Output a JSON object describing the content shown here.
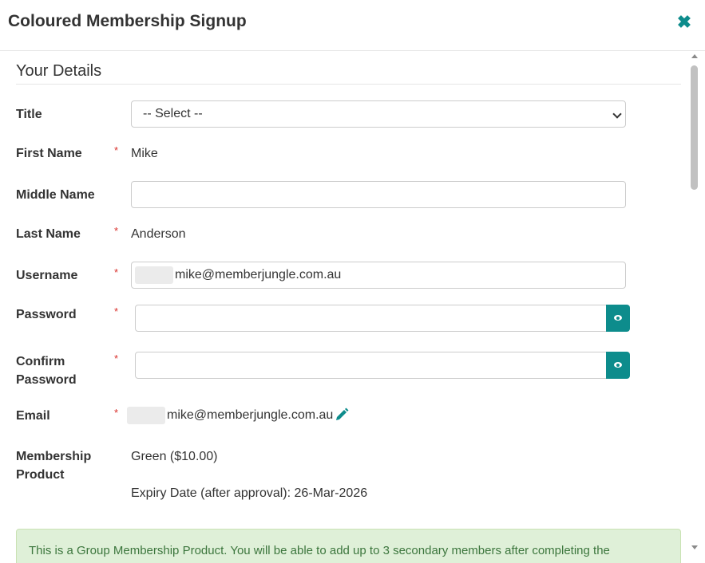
{
  "modal": {
    "title": "Coloured Membership Signup",
    "close_icon": "close-icon"
  },
  "section": {
    "title": "Your Details"
  },
  "fields": {
    "title": {
      "label": "Title",
      "selected": "-- Select --"
    },
    "first_name": {
      "label": "First Name",
      "required": "*",
      "value": "Mike"
    },
    "middle_name": {
      "label": "Middle Name",
      "value": ""
    },
    "last_name": {
      "label": "Last Name",
      "required": "*",
      "value": "Anderson"
    },
    "username": {
      "label": "Username",
      "required": "*",
      "value": "mike@memberjungle.com.au"
    },
    "password": {
      "label": "Password",
      "required": "*",
      "value": ""
    },
    "confirm_password": {
      "label_line1": "Confirm",
      "label_line2": "Password",
      "required": "*",
      "value": ""
    },
    "email": {
      "label": "Email",
      "required": "*",
      "value": "mike@memberjungle.com.au"
    },
    "membership_product": {
      "label_line1": "Membership",
      "label_line2": "Product",
      "product": "Green ($10.00)",
      "expiry": "Expiry Date (after approval): 26-Mar-2026"
    }
  },
  "alert": {
    "text": "This is a Group Membership Product. You will be able to add up to 3 secondary members after completing the"
  },
  "colors": {
    "accent": "#0d8c8c",
    "required": "#d9302c",
    "alert_bg": "#dff0d8",
    "alert_text": "#3c763d"
  }
}
